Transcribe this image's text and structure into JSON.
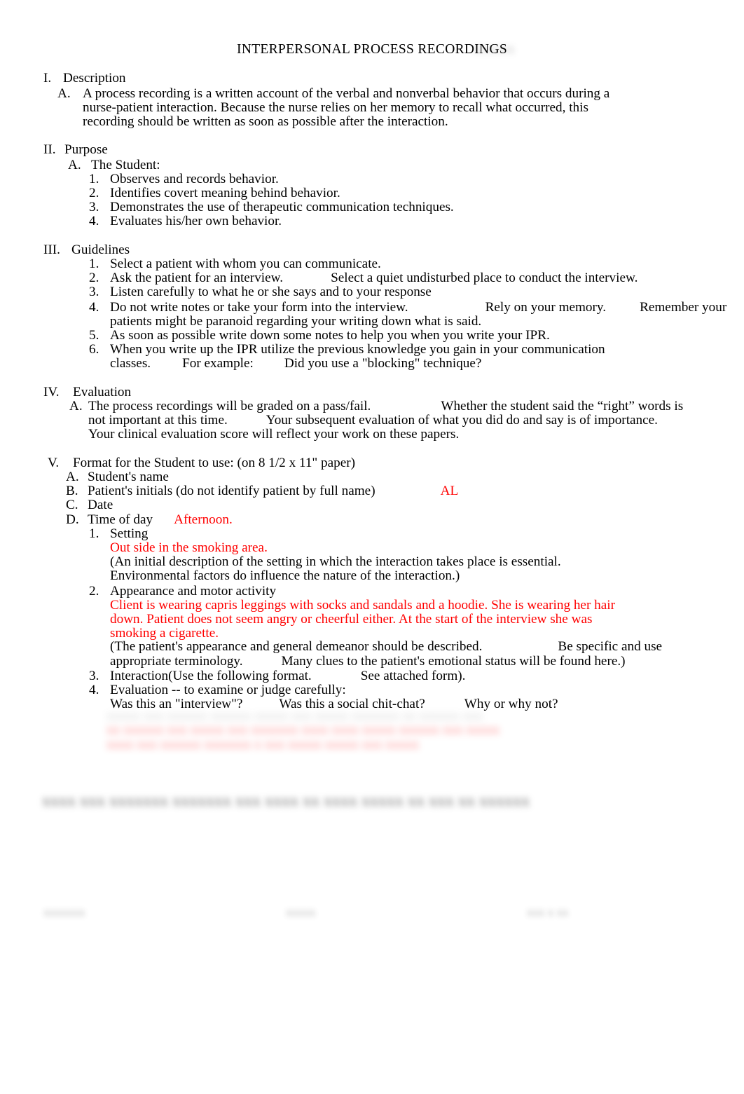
{
  "document": {
    "title": "INTERPERSONAL PROCESS RECORDINGS",
    "title_redacted": "xxxxxx",
    "accent_red": "#ff0000",
    "text_color": "#000000"
  },
  "sections": {
    "i": {
      "marker": "I.",
      "heading": "Description",
      "a": {
        "marker": "A.",
        "lines": [
          "A process recording is a written account of the verbal and nonverbal behavior that occurs during a",
          "nurse-patient interaction. Because the nurse relies on her memory to recall what occurred, this",
          "recording should be written as soon as possible after the interaction."
        ]
      }
    },
    "ii": {
      "marker": "II.",
      "heading": "Purpose",
      "a": {
        "marker": "A.",
        "text": "The Student:"
      },
      "items": [
        {
          "marker": "1.",
          "text": "Observes and records behavior."
        },
        {
          "marker": "2.",
          "text": "Identifies covert meaning behind behavior."
        },
        {
          "marker": "3.",
          "text": "Demonstrates the use of therapeutic communication techniques."
        },
        {
          "marker": "4.",
          "text": "Evaluates his/her own behavior."
        }
      ]
    },
    "iii": {
      "marker": "III.",
      "heading": "Guidelines",
      "items": [
        {
          "marker": "1.",
          "text": "Select a patient with whom you can communicate."
        },
        {
          "marker": "2.",
          "text": "Ask the patient for an interview.",
          "text2": "Select a quiet undisturbed place to conduct the interview."
        },
        {
          "marker": "3.",
          "text": "Listen carefully to what he or she says and to your response"
        },
        {
          "marker": "4.",
          "text": "Do not write notes or take your form into the interview.",
          "text2": "Rely on your memory.",
          "text3": "Remember your",
          "cont": "patients might be paranoid regarding your writing down what is said."
        },
        {
          "marker": "5.",
          "text": "As soon as possible write down some notes to help you when you write your IPR."
        },
        {
          "marker": "6.",
          "text": "When you write up the IPR utilize the previous knowledge you gain in your communication",
          "cont": "classes.",
          "cont2": "For example:",
          "cont3": "Did you use a \"blocking\" technique?"
        }
      ]
    },
    "iv": {
      "marker": "IV.",
      "heading": "Evaluation",
      "a": {
        "marker": "A.",
        "line1a": "The process recordings will be graded on a pass/fail.",
        "line1b": "Whether the student said the “right” words is",
        "line2a": "not important at this time.",
        "line2b": "Your subsequent evaluation of what you did do and say is of importance.",
        "line3": "Your clinical evaluation score will reflect your work on these papers."
      }
    },
    "v": {
      "marker": "V.",
      "heading": "Format for the Student to use: (on 8 1/2 x 11\" paper)",
      "a": {
        "marker": "A.",
        "text": "Student's name"
      },
      "b": {
        "marker": "B.",
        "text": "Patient's initials (do not identify patient by full name)",
        "answer": "AL"
      },
      "c": {
        "marker": "C.",
        "text": "Date"
      },
      "d": {
        "marker": "D.",
        "text": "Time of day",
        "answer": "Afternoon."
      },
      "items": [
        {
          "marker": "1.",
          "text": "Setting",
          "answer": "Out side in the smoking area.",
          "note": [
            "(An initial description of the setting in which the interaction takes place is essential.",
            "Environmental factors do influence the nature of the interaction.)"
          ]
        },
        {
          "marker": "2.",
          "text": "Appearance and motor activity",
          "answer": [
            "Client is wearing capris leggings with socks and sandals and a hoodie. She is wearing her hair",
            "down. Patient does not seem angry or cheerful either. At the start of the interview she was",
            "smoking a cigarette."
          ],
          "note_line1a": "(The patient's appearance and general demeanor should be described.",
          "note_line1b": "Be specific and use",
          "note_line2a": "appropriate terminology.",
          "note_line2b": "Many clues to the patient's emotional status will be found here.)"
        },
        {
          "marker": "3.",
          "text": "Interaction(Use the following format.",
          "text2": "See attached form)."
        },
        {
          "marker": "4.",
          "text": "Evaluation -- to examine or judge carefully:",
          "q1": "Was this an \"interview\"?",
          "q2": "Was this a social chit-chat?",
          "q3": "Why or why not?"
        }
      ]
    }
  },
  "redacted": {
    "answer_block_line1": "xxxxx xxx xxxxxx xxxxxx xxxxx xxx xxxxx xxxxxxx xx xxxxxx xxx",
    "answer_block_line2": "xx xxxxxx xxx xxxxx xxx xxxxxxx xxxx xxxx xxxxx xxxxxx xxx xxxxx",
    "answer_block_line3": "xxxx xxx xxxxxx xxxxxxx x xxx xxxxx xxxxx xxx xxxxx",
    "bold_line": "xxxx xxx xxxxxxx xxxxxxx xxx xxxx xx xxxx xxxxx xx xxx xx xxxxxx",
    "footer_left": "xxxxxxx",
    "footer_center": "xxxxx",
    "footer_right": "xxx x xx"
  }
}
